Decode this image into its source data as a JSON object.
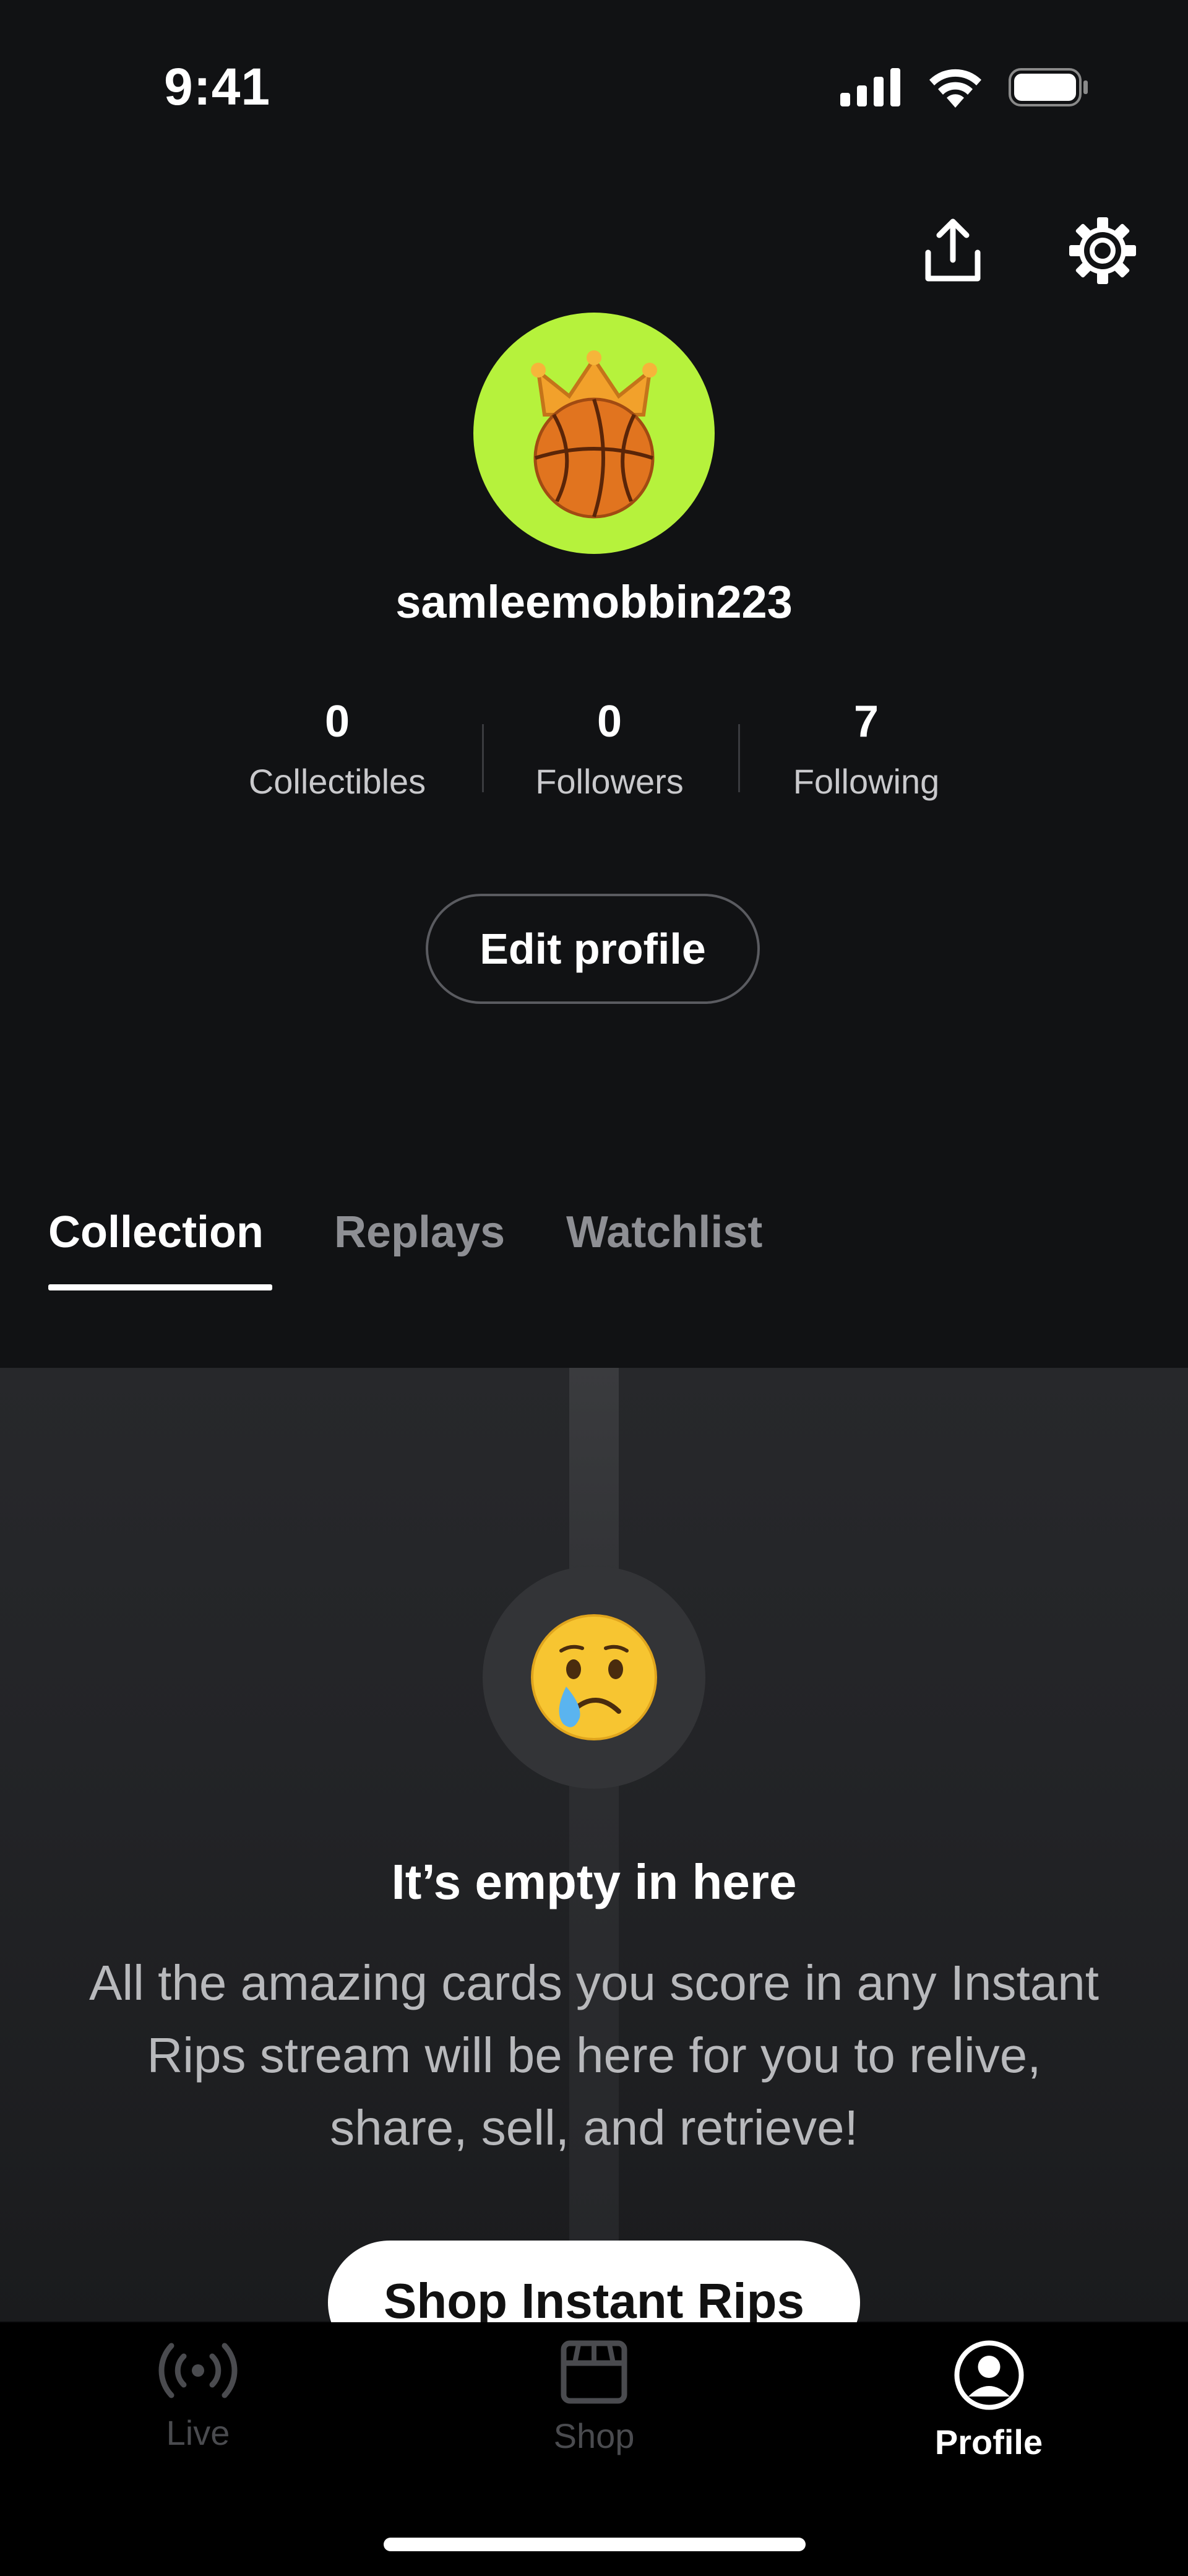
{
  "status_bar": {
    "time": "9:41"
  },
  "profile": {
    "username": "samleemobbin223",
    "edit_label": "Edit profile",
    "stats": [
      {
        "value": "0",
        "label": "Collectibles"
      },
      {
        "value": "0",
        "label": "Followers"
      },
      {
        "value": "7",
        "label": "Following"
      }
    ]
  },
  "tabs": [
    {
      "label": "Collection",
      "active": true
    },
    {
      "label": "Replays",
      "active": false
    },
    {
      "label": "Watchlist",
      "active": false
    }
  ],
  "empty_state": {
    "title": "It’s empty in here",
    "body": "All the amazing cards you score in any Instant Rips stream will be here for you to relive, share, sell, and retrieve!",
    "cta": "Shop Instant Rips"
  },
  "nav": [
    {
      "label": "Live",
      "icon": "live-broadcast-icon",
      "active": false
    },
    {
      "label": "Shop",
      "icon": "storefront-icon",
      "active": false
    },
    {
      "label": "Profile",
      "icon": "profile-user-icon",
      "active": true
    }
  ],
  "colors": {
    "avatar_bg": "#b6f23c",
    "background": "#111214",
    "accent": "#ffffff"
  }
}
